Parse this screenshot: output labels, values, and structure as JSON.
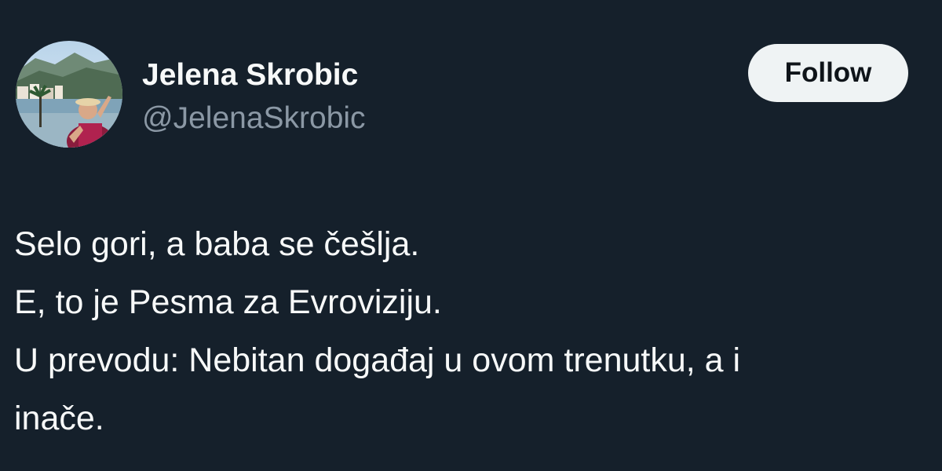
{
  "author": {
    "display_name": "Jelena Skrobic",
    "handle": "@JelenaSkrobic",
    "avatar_icon": "profile-photo-avatar"
  },
  "follow_button": {
    "label": "Follow"
  },
  "tweet": {
    "lines": [
      "Selo gori, a baba se češlja.",
      "E, to je Pesma za Evroviziju.",
      "U prevodu: Nebitan događaj u ovom trenutku, a i",
      "inače."
    ]
  },
  "colors": {
    "background": "#15202b",
    "primary_text": "#f7f9f9",
    "secondary_text": "#8b98a5",
    "button_bg": "#eff3f4",
    "button_text": "#0f1419"
  }
}
